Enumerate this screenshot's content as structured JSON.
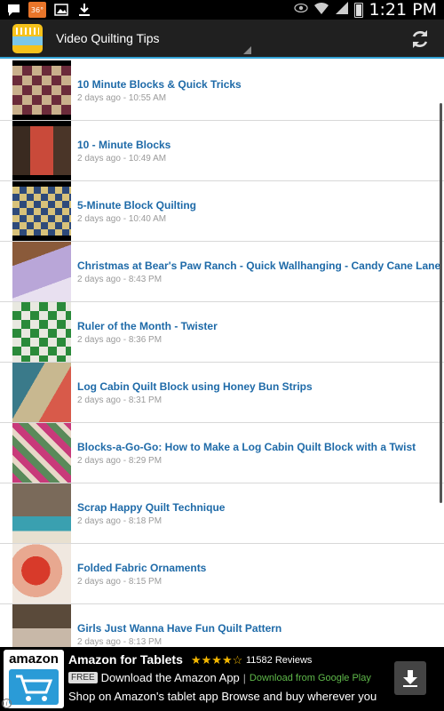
{
  "status_bar": {
    "temperature": "36°",
    "time": "1:21 PM"
  },
  "app_bar": {
    "title": "Video Quilting Tips"
  },
  "videos": [
    {
      "title": "10 Minute Blocks & Quick Tricks",
      "time": "2 days ago - 10:55 AM"
    },
    {
      "title": "10 - Minute Blocks",
      "time": "2 days ago - 10:49 AM"
    },
    {
      "title": "5-Minute Block Quilting",
      "time": "2 days ago - 10:40 AM"
    },
    {
      "title": "Christmas at Bear's Paw Ranch - Quick Wallhanging - Candy Cane Lane",
      "time": "2 days ago - 8:43 PM"
    },
    {
      "title": "Ruler of the Month - Twister",
      "time": "2 days ago - 8:36 PM"
    },
    {
      "title": "Log Cabin Quilt Block using Honey Bun Strips",
      "time": "2 days ago - 8:31 PM"
    },
    {
      "title": "Blocks-a-Go-Go: How to Make a Log Cabin Quilt Block with a Twist",
      "time": "2 days ago - 8:29 PM"
    },
    {
      "title": "Scrap Happy Quilt Technique",
      "time": "2 days ago - 8:18 PM"
    },
    {
      "title": "Folded Fabric Ornaments",
      "time": "2 days ago - 8:15 PM"
    },
    {
      "title": "Girls Just Wanna Have Fun Quilt Pattern",
      "time": "2 days ago - 8:13 PM"
    }
  ],
  "ad": {
    "logo_text": "amazon",
    "title": "Amazon for Tablets",
    "stars": "★★★★☆",
    "rating": 4,
    "reviews": "11582 Reviews",
    "free_label": "FREE",
    "cta_main": "Download the Amazon App",
    "separator": "|",
    "cta_sub": "Download from Google Play",
    "description": "Shop on Amazon's tablet app Browse and buy wherever you",
    "info": "i"
  },
  "colors": {
    "title_link": "#1e6aa8",
    "appbar_accent": "#33a3d6",
    "ad_stars": "#f5b800",
    "ad_google_play": "#5fb94a"
  },
  "icons": [
    "chat-icon",
    "temperature-badge-icon",
    "image-icon",
    "download-icon",
    "eye-icon",
    "wifi-icon",
    "signal-icon",
    "battery-icon",
    "refresh-icon",
    "dropdown-triangle-icon",
    "download-arrow-icon"
  ]
}
